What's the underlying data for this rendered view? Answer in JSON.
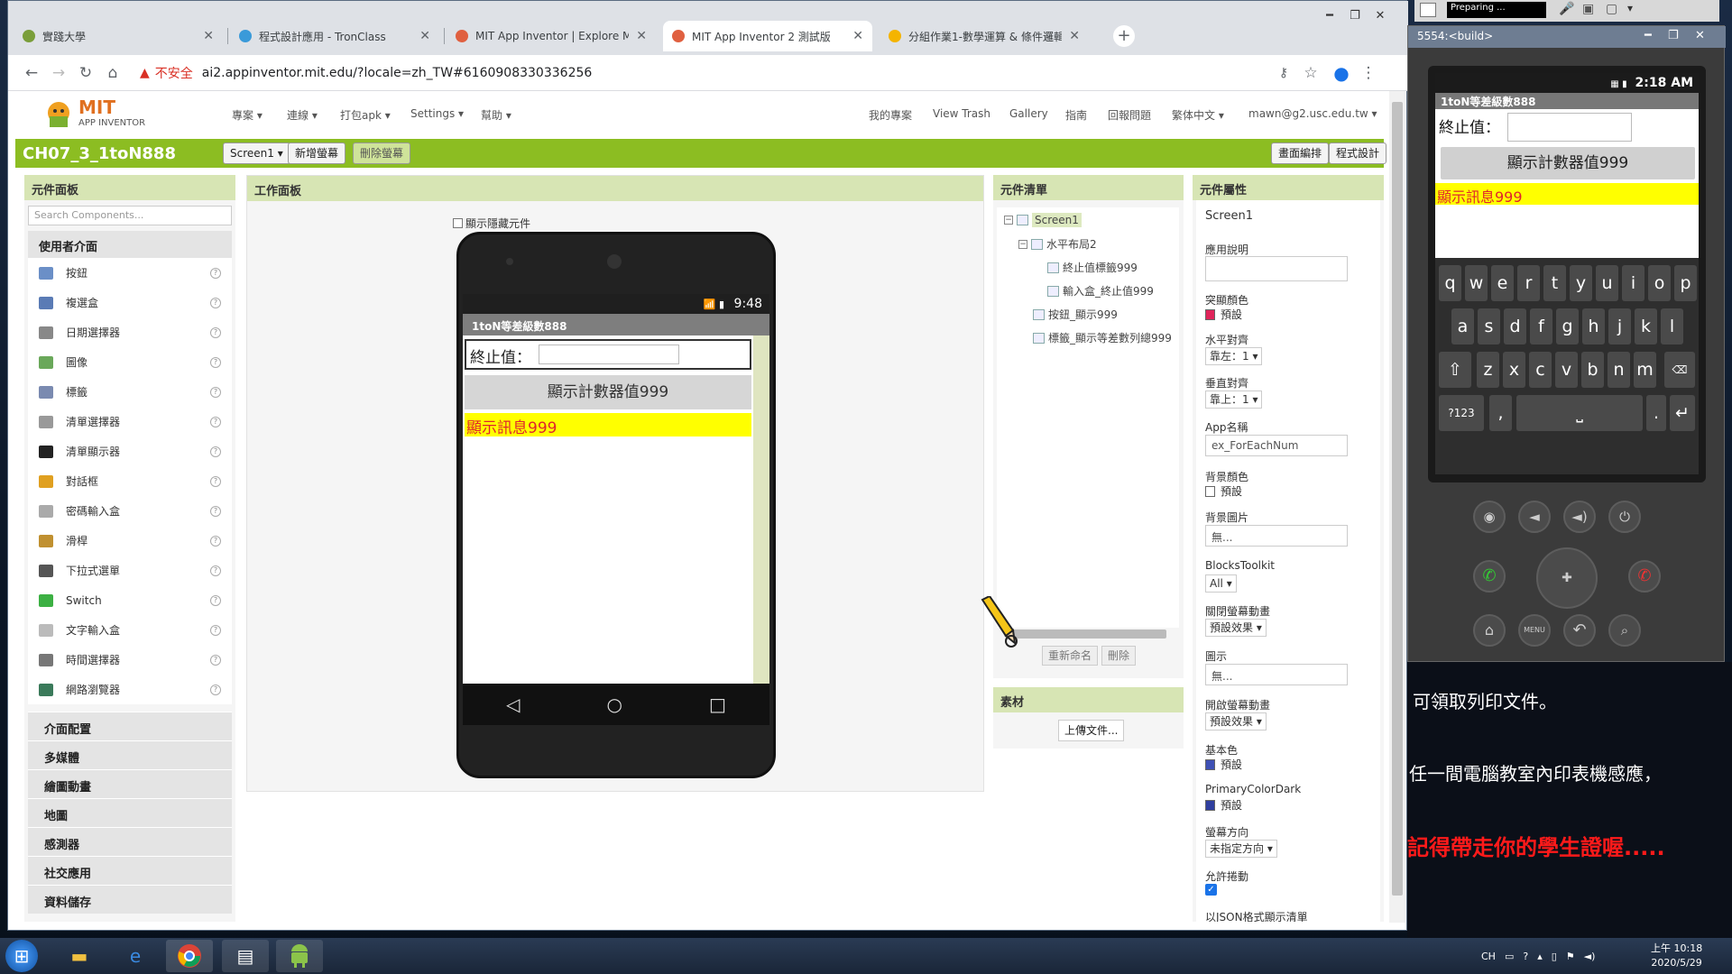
{
  "browser": {
    "tabs": [
      {
        "label": "實踐大學",
        "active": false
      },
      {
        "label": "程式設計應用 - TronClass",
        "active": false
      },
      {
        "label": "MIT App Inventor | Explore MIT",
        "active": false
      },
      {
        "label": "MIT App Inventor 2 測試版",
        "active": true
      },
      {
        "label": "分組作業1-數學運算 & 條件邏輯",
        "active": false
      }
    ],
    "insecure_label": "不安全",
    "url": "ai2.appinventor.mit.edu/?locale=zh_TW#6160908330336256"
  },
  "ai": {
    "logo_title": "MIT",
    "logo_subtitle": "APP INVENTOR",
    "menu_left": [
      "專案 ▾",
      "連線 ▾",
      "打包apk ▾",
      "Settings ▾",
      "幫助 ▾"
    ],
    "menu_right": [
      "我的專案",
      "View Trash",
      "Gallery",
      "指南",
      "回報問題",
      "繁体中文 ▾",
      "mawn@g2.usc.edu.tw ▾"
    ],
    "project_name": "CH07_3_1toN888",
    "screen_select": "Screen1 ▾",
    "add_screen": "新增螢幕",
    "remove_screen": "刪除螢幕",
    "designer_btn": "畫面編排",
    "blocks_btn": "程式設計"
  },
  "palette": {
    "header": "元件面板",
    "search_placeholder": "Search Components...",
    "group_header": "使用者介面",
    "items": [
      {
        "label": "按鈕",
        "icon": "button-icon",
        "color": "#6b8fc7"
      },
      {
        "label": "複選盒",
        "icon": "checkbox-icon",
        "color": "#5a7bb5"
      },
      {
        "label": "日期選擇器",
        "icon": "datepicker-icon",
        "color": "#888888"
      },
      {
        "label": "圖像",
        "icon": "image-icon",
        "color": "#6aa85a"
      },
      {
        "label": "標籤",
        "icon": "label-icon",
        "color": "#7a8ab0"
      },
      {
        "label": "清單選擇器",
        "icon": "listpicker-icon",
        "color": "#999999"
      },
      {
        "label": "清單顯示器",
        "icon": "listview-icon",
        "color": "#222222"
      },
      {
        "label": "對話框",
        "icon": "notifier-icon",
        "color": "#e0a020"
      },
      {
        "label": "密碼輸入盒",
        "icon": "passwordtextbox-icon",
        "color": "#aaaaaa"
      },
      {
        "label": "滑桿",
        "icon": "slider-icon",
        "color": "#c09030"
      },
      {
        "label": "下拉式選單",
        "icon": "spinner-icon",
        "color": "#555555"
      },
      {
        "label": "Switch",
        "icon": "switch-icon",
        "color": "#3cb043"
      },
      {
        "label": "文字輸入盒",
        "icon": "textbox-icon",
        "color": "#bbbbbb"
      },
      {
        "label": "時間選擇器",
        "icon": "timepicker-icon",
        "color": "#777777"
      },
      {
        "label": "網路瀏覽器",
        "icon": "webviewer-icon",
        "color": "#3a7a5a"
      }
    ],
    "categories": [
      "介面配置",
      "多媒體",
      "繪圖動畫",
      "地圖",
      "感測器",
      "社交應用",
      "資料儲存"
    ]
  },
  "viewer": {
    "header": "工作面板",
    "show_hidden": "顯示隱藏元件",
    "phone_time": "9:48",
    "app_title": "1toN等差級數888",
    "end_label": "終止值：",
    "button_text": "顯示計數器值999",
    "message_text": "顯示訊息999"
  },
  "tree": {
    "header": "元件清單",
    "nodes": [
      {
        "label": "Screen1",
        "level": 0
      },
      {
        "label": "水平布局2",
        "level": 1
      },
      {
        "label": "終止值標籤999",
        "level": 2
      },
      {
        "label": "輸入盒_終止值999",
        "level": 2
      },
      {
        "label": "按鈕_顯示999",
        "level": 1
      },
      {
        "label": "標籤_顯示等差數列總999",
        "level": 1
      }
    ],
    "rename_btn": "重新命名",
    "delete_btn": "刪除"
  },
  "media": {
    "header": "素材",
    "upload_btn": "上傳文件..."
  },
  "props": {
    "header": "元件屬性",
    "component": "Screen1",
    "about_label": "應用說明",
    "accent_label": "突顯顏色",
    "accent_value": "預設",
    "accent_color": "#e0245a",
    "align_h_label": "水平對齊",
    "align_h_value": "靠左：1 ▾",
    "align_v_label": "垂直對齊",
    "align_v_value": "靠上：1 ▾",
    "appname_label": "App名稱",
    "appname_value": "ex_ForEachNum",
    "bgcolor_label": "背景顏色",
    "bgcolor_value": "預設",
    "bgimage_label": "背景圖片",
    "bgimage_value": "無...",
    "blocks_toolkit_label": "BlocksToolkit",
    "blocks_toolkit_value": "All ▾",
    "close_anim_label": "關閉螢幕動畫",
    "close_anim_value": "預設效果 ▾",
    "icon_label": "圖示",
    "icon_value": "無...",
    "open_anim_label": "開啟螢幕動畫",
    "open_anim_value": "預設效果 ▾",
    "primary_label": "基本色",
    "primary_value": "預設",
    "primary_color": "#3f51b5",
    "primary_dark_label": "PrimaryColorDark",
    "primary_dark_value": "預設",
    "primary_dark_color": "#303f9f",
    "orientation_label": "螢幕方向",
    "orientation_value": "未指定方向 ▾",
    "scroll_label": "允許捲動",
    "scroll_checked": true,
    "json_label": "以JSON格式顯示清單"
  },
  "emulator": {
    "toolbar_status": "Preparing ...",
    "title": "5554:<build>",
    "time": "2:18 AM",
    "app_title": "1toN等差級數888",
    "end_label": "終止值：",
    "button_text": "顯示計數器值999",
    "message_text": "顯示訊息999",
    "row1": [
      "q",
      "w",
      "e",
      "r",
      "t",
      "y",
      "u",
      "i",
      "o",
      "p"
    ],
    "row2": [
      "a",
      "s",
      "d",
      "f",
      "g",
      "h",
      "j",
      "k",
      "l"
    ],
    "row3": [
      "z",
      "x",
      "c",
      "v",
      "b",
      "n",
      "m"
    ],
    "sym_key": "?123",
    "menu_key": "MENU"
  },
  "overlay": {
    "line1": "可領取列印文件。",
    "line2": "任一間電腦教室內印表機感應，",
    "line3": "記得帶走你的學生證喔....."
  },
  "taskbar": {
    "lang": "CH",
    "time": "上午 10:18",
    "date": "2020/5/29"
  }
}
